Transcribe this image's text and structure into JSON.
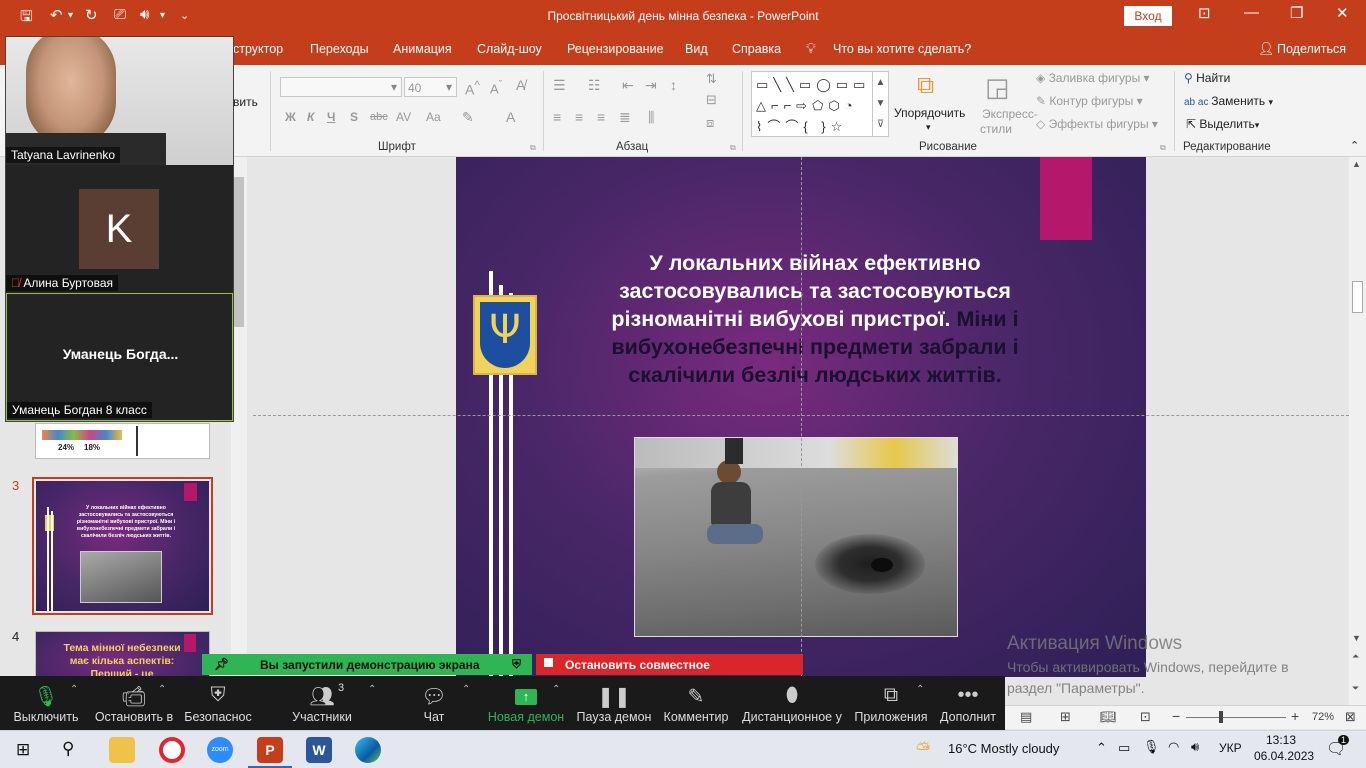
{
  "window": {
    "title": "Просвітницький день мінна безпека  -  PowerPoint",
    "login_label": "Вход",
    "accent": "#c43e1c"
  },
  "menu": {
    "items": [
      "структор",
      "Переходы",
      "Анимация",
      "Слайд-шоу",
      "Рецензирование",
      "Вид",
      "Справка"
    ],
    "tell_me": "Что вы хотите сделать?",
    "share": "Поделиться"
  },
  "ribbon": {
    "paste_fragment": "вить",
    "font_size": "40",
    "font_group": "Шрифт",
    "paragraph_group": "Абзац",
    "drawing_group": "Рисование",
    "editing_group": "Редактирование",
    "arrange": "Упорядочить",
    "quick_styles": [
      "Экспресс-",
      "стили"
    ],
    "shape_fill": "Заливка фигуры",
    "shape_outline": "Контур фигуры",
    "shape_effects": "Эффекты фигуры",
    "find": "Найти",
    "replace": "Заменить",
    "select": "Выделить",
    "font_buttons": [
      "Ж",
      "К",
      "Ч",
      "S",
      "abc",
      "AV",
      "Aa",
      "A"
    ]
  },
  "thumbnails": {
    "slide3_num": "3",
    "slide4_num": "4",
    "slide2_stats": [
      "24%",
      "18%"
    ],
    "slide3_text": "У локальних війнах ефективно застосовувались та застосовуються різноманітні вибухові пристрої. Міни і вибухонебезпечні предмети забрали і скалічили безліч людських життів.",
    "slide4_text": "Тема мінної небезпеки має кілька аспектів: Перший - це національна"
  },
  "slide": {
    "text_light": "У локальних війнах ефективно застосовувались та застосовуються різноманітні вибухові пристрої.",
    "text_dark": "Міни і вибухонебезпечні предмети забрали і скалічили безліч людських життів."
  },
  "watermark": {
    "line1": "Активация Windows",
    "line2": "Чтобы активировать Windows, перейдите в раздел \"Параметры\"."
  },
  "statusbar": {
    "zoom": "72%"
  },
  "zoom_video": {
    "tile1_name": "Tatyana Lavrinenko",
    "tile2_initial": "K",
    "tile2_name": "Алина Буртовая",
    "tile3_display": "Уманець  Богда...",
    "tile3_name": "Уманець Богдан 8 класс"
  },
  "share_banner": {
    "green": "Вы запустили демонстрацию экрана",
    "red": "Остановить совместное использование"
  },
  "zoom_toolbar": {
    "mute": "Выключить",
    "video": "Остановить в",
    "security": "Безопаснос",
    "participants": "Участники",
    "participants_count": "3",
    "chat": "Чат",
    "new_share": "Новая демон",
    "pause_share": "Пауза демон",
    "annotate": "Комментир",
    "remote": "Дистанционное у",
    "apps": "Приложения",
    "more": "Дополнит"
  },
  "taskbar": {
    "weather": "16°C  Mostly cloudy",
    "lang": "УКР",
    "time": "13:13",
    "date": "06.04.2023",
    "notifications": "1"
  }
}
